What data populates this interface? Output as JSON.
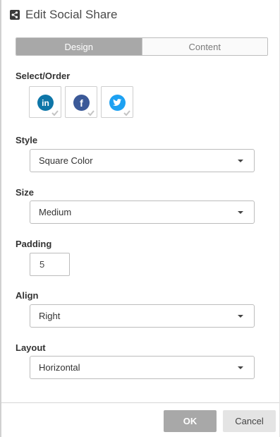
{
  "dialog": {
    "title": "Edit Social Share",
    "icon": "share-icon"
  },
  "tabs": [
    {
      "label": "Design",
      "active": true
    },
    {
      "label": "Content",
      "active": false
    }
  ],
  "select_order": {
    "label": "Select/Order",
    "networks": [
      {
        "name": "LinkedIn",
        "glyph": "in",
        "color": "#0e76a8",
        "checked": true
      },
      {
        "name": "Facebook",
        "glyph": "f",
        "color": "#3b5998",
        "checked": true
      },
      {
        "name": "Twitter",
        "glyph": "twitter-bird",
        "color": "#1da1f2",
        "checked": true
      }
    ]
  },
  "style": {
    "label": "Style",
    "value": "Square Color"
  },
  "size": {
    "label": "Size",
    "value": "Medium"
  },
  "padding": {
    "label": "Padding",
    "value": "5"
  },
  "align": {
    "label": "Align",
    "value": "Right"
  },
  "layout": {
    "label": "Layout",
    "value": "Horizontal"
  },
  "footer": {
    "ok_label": "OK",
    "cancel_label": "Cancel"
  },
  "colors": {
    "accent_gray": "#a8a8a8",
    "linkedin": "#0e76a8",
    "facebook": "#3b5998",
    "twitter": "#1da1f2"
  }
}
